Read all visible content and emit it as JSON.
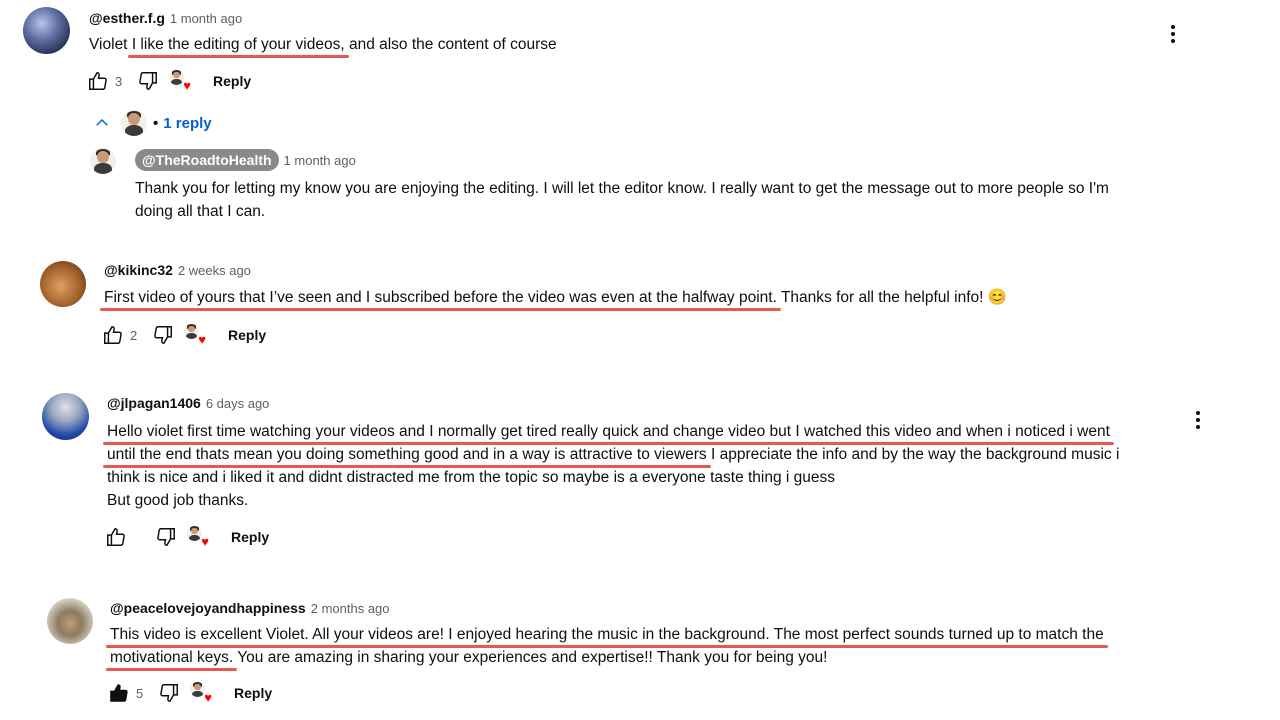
{
  "comments": [
    {
      "handle": "@esther.f.g",
      "time": "1 month ago",
      "lines": [
        {
          "a": "Violet ",
          "b": "I like the editing of your videos,",
          "c": " and also the content of course"
        }
      ],
      "likes": "3",
      "reply_label": "Reply",
      "replies_toggle": "1 reply",
      "reply": {
        "handle": "@TheRoadtoHealth",
        "time": "1 month ago",
        "line1": "Thank you for letting my know you are enjoying the editing. I will let the editor know. I really want to get the message out to more people so I'm",
        "line2": "doing all that I can."
      }
    },
    {
      "handle": "@kikinc32",
      "time": "2 weeks ago",
      "hl": "First video of yours that I’ve seen and I subscribed before the video was even at the halfway point.",
      "rest": " Thanks for all the helpful info! 😊",
      "likes": "2",
      "reply_label": "Reply"
    },
    {
      "handle": "@jlpagan1406",
      "time": "6 days ago",
      "line1": "Hello violet first time watching your videos and I normally get tired really quick and change video but I watched this video and when i noticed i went",
      "line2_hl": "until the end thats mean you doing something good and in a way is attractive to viewers",
      "line2_rest": " I appreciate the info and by the way the background music i",
      "line3": "think is nice and i liked it and didnt distracted me from the topic so maybe is a everyone taste thing i guess",
      "line4": "But good job thanks.",
      "likes": "",
      "reply_label": "Reply"
    },
    {
      "handle": "@peacelovejoyandhappiness",
      "time": "2 months ago",
      "line1": "This video is excellent Violet. All your videos are! I enjoyed hearing the music in the background.  The most perfect sounds turned up to match the",
      "line2_hl": "motivational keys.",
      "line2_rest": " You are amazing in sharing your experiences and expertise!! Thank you for being you!",
      "likes": "5",
      "reply_label": "Reply"
    }
  ],
  "icons": {
    "like": "thumbs-up-icon",
    "dislike": "thumbs-down-icon",
    "creator_heart": "creator-heart-icon",
    "more": "more-vert-icon",
    "chevron": "chevron-up-icon"
  },
  "colors": {
    "link_blue": "#065fd4",
    "underline_red": "#e53935",
    "heart_red": "#ff0000"
  }
}
